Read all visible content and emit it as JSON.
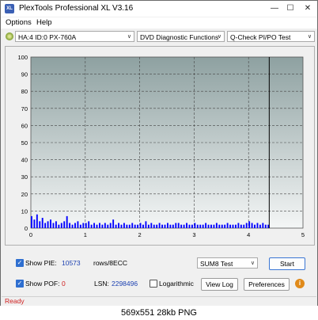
{
  "window": {
    "title": "PlexTools Professional XL V3.16",
    "app_icon_text": "XL"
  },
  "menu": {
    "options": "Options",
    "help": "Help"
  },
  "toolbar": {
    "drive": "HA:4 ID:0  PX-760A",
    "function": "DVD Diagnostic Functions",
    "test": "Q-Check PI/PO Test"
  },
  "chart_data": {
    "type": "bar",
    "xlim": [
      0,
      5
    ],
    "ylim": [
      0,
      100
    ],
    "x_ticks": [
      "0",
      "1",
      "2",
      "3",
      "4",
      "5"
    ],
    "y_ticks": [
      "0",
      "10",
      "20",
      "30",
      "40",
      "50",
      "60",
      "70",
      "80",
      "90",
      "100"
    ],
    "grid": true,
    "end_marker_x": 4.38,
    "series": [
      {
        "color": "#0000ff",
        "x": [
          0.0,
          0.05,
          0.1,
          0.15,
          0.2,
          0.25,
          0.3,
          0.35,
          0.4,
          0.45,
          0.5,
          0.55,
          0.6,
          0.65,
          0.7,
          0.75,
          0.8,
          0.85,
          0.9,
          0.95,
          1.0,
          1.05,
          1.1,
          1.15,
          1.2,
          1.25,
          1.3,
          1.35,
          1.4,
          1.45,
          1.5,
          1.55,
          1.6,
          1.65,
          1.7,
          1.75,
          1.8,
          1.85,
          1.9,
          1.95,
          2.0,
          2.05,
          2.1,
          2.15,
          2.2,
          2.25,
          2.3,
          2.35,
          2.4,
          2.45,
          2.5,
          2.55,
          2.6,
          2.65,
          2.7,
          2.75,
          2.8,
          2.85,
          2.9,
          2.95,
          3.0,
          3.05,
          3.1,
          3.15,
          3.2,
          3.25,
          3.3,
          3.35,
          3.4,
          3.45,
          3.5,
          3.55,
          3.6,
          3.65,
          3.7,
          3.75,
          3.8,
          3.85,
          3.9,
          3.95,
          4.0,
          4.05,
          4.1,
          4.15,
          4.2,
          4.25,
          4.3,
          4.35
        ],
        "values": [
          7,
          5,
          8,
          4,
          6,
          3,
          4,
          5,
          3,
          4,
          2,
          3,
          4,
          7,
          3,
          2,
          3,
          4,
          2,
          3,
          3,
          4,
          2,
          3,
          2,
          3,
          2,
          3,
          2,
          3,
          5,
          2,
          3,
          2,
          3,
          2,
          2,
          3,
          2,
          2,
          3,
          2,
          4,
          2,
          3,
          2,
          2,
          3,
          2,
          2,
          3,
          2,
          2,
          3,
          3,
          2,
          2,
          3,
          2,
          2,
          3,
          2,
          2,
          2,
          3,
          2,
          2,
          2,
          3,
          2,
          2,
          2,
          3,
          2,
          2,
          2,
          3,
          2,
          2,
          3,
          4,
          3,
          2,
          3,
          2,
          3,
          2,
          2
        ]
      }
    ]
  },
  "bottom": {
    "show_pie_label": "Show PIE:",
    "pie_value": "10573",
    "rows_label": "rows/8ECC",
    "sum_select": "SUM8 Test",
    "start_label": "Start",
    "show_pof_label": "Show POF:",
    "pof_value": "0",
    "lsn_label": "LSN:",
    "lsn_value": "2298496",
    "logarithmic_label": "Logarithmic",
    "view_log_label": "View Log",
    "preferences_label": "Preferences",
    "info_label": "i"
  },
  "status": {
    "text": "Ready"
  },
  "caption": {
    "text": "569x551  28kb PNG"
  }
}
